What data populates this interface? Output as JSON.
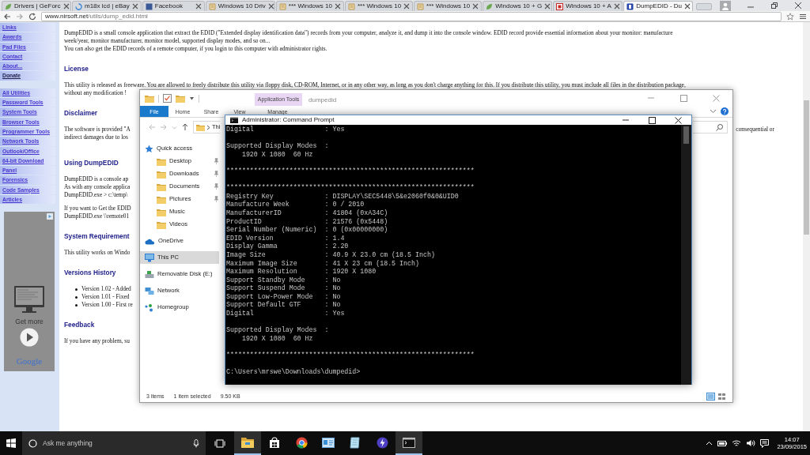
{
  "browser": {
    "tabs": [
      {
        "label": "Drivers | GeForc",
        "selected": false
      },
      {
        "label": "m18x lcd | eBay",
        "selected": false
      },
      {
        "label": "Facebook",
        "selected": false
      },
      {
        "label": "Windows 10 Driv",
        "selected": false
      },
      {
        "label": "*** Windows 10",
        "selected": false
      },
      {
        "label": "*** Windows 10",
        "selected": false
      },
      {
        "label": "*** Windows 10",
        "selected": false
      },
      {
        "label": "Windows 10 + G",
        "selected": false
      },
      {
        "label": "Windows 10 + A",
        "selected": false
      },
      {
        "label": "DumpEDID - Du",
        "selected": true
      }
    ],
    "address": {
      "host": "www.nirsoft.net",
      "path": "/utils/dump_edid.html"
    }
  },
  "sidebar": {
    "groups": [
      {
        "items": [
          {
            "label": "Links",
            "selected": false
          },
          {
            "label": "Awards",
            "selected": false
          },
          {
            "label": "Pad Files",
            "selected": false
          },
          {
            "label": "Contact",
            "selected": false
          },
          {
            "label": "About...",
            "selected": false
          },
          {
            "label": "Donate",
            "selected": true
          }
        ]
      },
      {
        "items": [
          {
            "label": "All Utilities",
            "selected": false
          },
          {
            "label": "Password Tools",
            "selected": false
          },
          {
            "label": "System Tools",
            "selected": false
          },
          {
            "label": "Browser Tools",
            "selected": false
          },
          {
            "label": "Programmer Tools",
            "selected": false
          },
          {
            "label": "Network Tools",
            "selected": false
          },
          {
            "label": "Outlook/Office",
            "selected": false
          },
          {
            "label": "64-bit Download",
            "selected": false
          },
          {
            "label": "Panel",
            "selected": false
          },
          {
            "label": "Forensics",
            "selected": false
          },
          {
            "label": "Code Samples",
            "selected": false
          },
          {
            "label": "Articles",
            "selected": false
          }
        ]
      }
    ]
  },
  "ad": {
    "headline": "Get more",
    "brand": "Google"
  },
  "article": {
    "blocks": [
      {
        "kind": "para",
        "lines": [
          "DumpEDID is a small console application that extract the EDID (\"Extended display identification data\") records from your computer, analyze it, and dump it into the console window. EDID record provide essential information about your monitor: manufacture",
          "week/year, monitor manufacturer, monitor model, supported display modes, and so on...",
          "You can also get the EDID records of a remote computer, if you login to this computer with administrator rights."
        ]
      },
      {
        "kind": "heading",
        "text": "License"
      },
      {
        "kind": "para",
        "lines": [
          "This utility is released as freeware. You are allowed to freely distribute this utility via floppy disk, CD-ROM, Internet, or in any other way, as long as you don't charge anything for this. If you distribute this utility, you must include all files in the distribution package,",
          "without any modification !"
        ]
      },
      {
        "kind": "heading",
        "text": "Disclaimer"
      },
      {
        "kind": "para",
        "lines": [
          "The software is provided \"A",
          "indirect damages due to los"
        ],
        "right_text": "consequential or"
      },
      {
        "kind": "heading",
        "text": "Using DumpEDID"
      },
      {
        "kind": "para",
        "lines": [
          "DumpEDID is a console ap",
          "As with any console applica",
          "DumpEDID.exe > c:\\temp\\"
        ]
      },
      {
        "kind": "para",
        "lines": [
          "If you want to Get the EDID",
          "DumpEDID.exe \\\\remote01"
        ]
      },
      {
        "kind": "heading",
        "text": "System Requirement"
      },
      {
        "kind": "para",
        "lines": [
          "This utility works on Windo"
        ]
      },
      {
        "kind": "heading",
        "text": "Versions History"
      },
      {
        "kind": "list",
        "items": [
          "Version 1.02 - Added",
          "Version 1.01 - Fixed",
          "Version 1.00 - First re"
        ]
      },
      {
        "kind": "heading",
        "text": "Feedback"
      },
      {
        "kind": "para",
        "lines": [
          "If you have any problem, su"
        ]
      }
    ]
  },
  "explorer": {
    "title": "dumpedid",
    "context_tab": "Application Tools",
    "ribbon_tabs": [
      {
        "label": "File",
        "selected": true
      },
      {
        "label": "Home",
        "selected": false
      },
      {
        "label": "Share",
        "selected": false
      },
      {
        "label": "View",
        "selected": false
      },
      {
        "label": "Manage",
        "selected": false
      }
    ],
    "path": "Thi",
    "nav": [
      {
        "label": "Quick access",
        "kind": "star",
        "pinned": false,
        "selected": false,
        "children": [
          {
            "label": "Desktop",
            "kind": "folder",
            "pinned": true,
            "selected": false
          },
          {
            "label": "Downloads",
            "kind": "folder",
            "pinned": true,
            "selected": false
          },
          {
            "label": "Documents",
            "kind": "folder",
            "pinned": true,
            "selected": false
          },
          {
            "label": "Pictures",
            "kind": "folder",
            "pinned": true,
            "selected": false
          },
          {
            "label": "Music",
            "kind": "folder",
            "pinned": false,
            "selected": false
          },
          {
            "label": "Videos",
            "kind": "folder",
            "pinned": false,
            "selected": false
          }
        ]
      },
      {
        "label": "OneDrive",
        "kind": "cloud",
        "pinned": false,
        "selected": false
      },
      {
        "label": "This PC",
        "kind": "pc",
        "pinned": false,
        "selected": true
      },
      {
        "label": "Removable Disk (E:)",
        "kind": "drive",
        "pinned": false,
        "selected": false
      },
      {
        "label": "Network",
        "kind": "network",
        "pinned": false,
        "selected": false
      },
      {
        "label": "Homegroup",
        "kind": "homegroup",
        "pinned": false,
        "selected": false
      }
    ],
    "status": [
      "3 items",
      "1 item selected",
      "9.50 KB"
    ]
  },
  "console": {
    "title": "Administrator: Command Prompt",
    "blocks": [
      [
        "Digital                  : Yes"
      ],
      [
        "Supported Display Modes  :",
        "    1920 X 1080  60 Hz"
      ],
      [
        "***************************************************************"
      ],
      [
        "***************************************************************",
        "Registry Key             : DISPLAY\\SEC5448\\5&e2060f0&0&UID0",
        "Manufacture Week         : 0 / 2010",
        "ManufacturerID           : 41804 (0xA34C)",
        "ProductID                : 21576 (0x5448)",
        "Serial Number (Numeric)  : 0 (0x00000000)",
        "EDID Version             : 1.4",
        "Display Gamma            : 2.20",
        "Image Size               : 40.9 X 23.0 cm (18.5 Inch)",
        "Maximum Image Size       : 41 X 23 cm (18.5 Inch)",
        "Maximum Resolution       : 1920 X 1080",
        "Support Standby Mode     : No",
        "Support Suspend Mode     : No",
        "Support Low-Power Mode   : No",
        "Support Default GTF      : No",
        "Digital                  : Yes"
      ],
      [
        "Supported Display Modes  :",
        "    1920 X 1080  60 Hz"
      ],
      [
        "***************************************************************"
      ],
      [
        "C:\\Users\\mrswe\\Downloads\\dumpedid>"
      ]
    ]
  },
  "taskbar": {
    "search_placeholder": "Ask me anything",
    "apps": [
      {
        "kind": "folder",
        "active": true
      },
      {
        "kind": "store",
        "active": false
      },
      {
        "kind": "browser",
        "active": false
      },
      {
        "kind": "card",
        "active": false
      },
      {
        "kind": "notepad",
        "active": false
      },
      {
        "kind": "bolt",
        "active": false
      },
      {
        "kind": "terminal",
        "active": true
      }
    ],
    "time": "14:07",
    "date": "23/09/2015"
  }
}
